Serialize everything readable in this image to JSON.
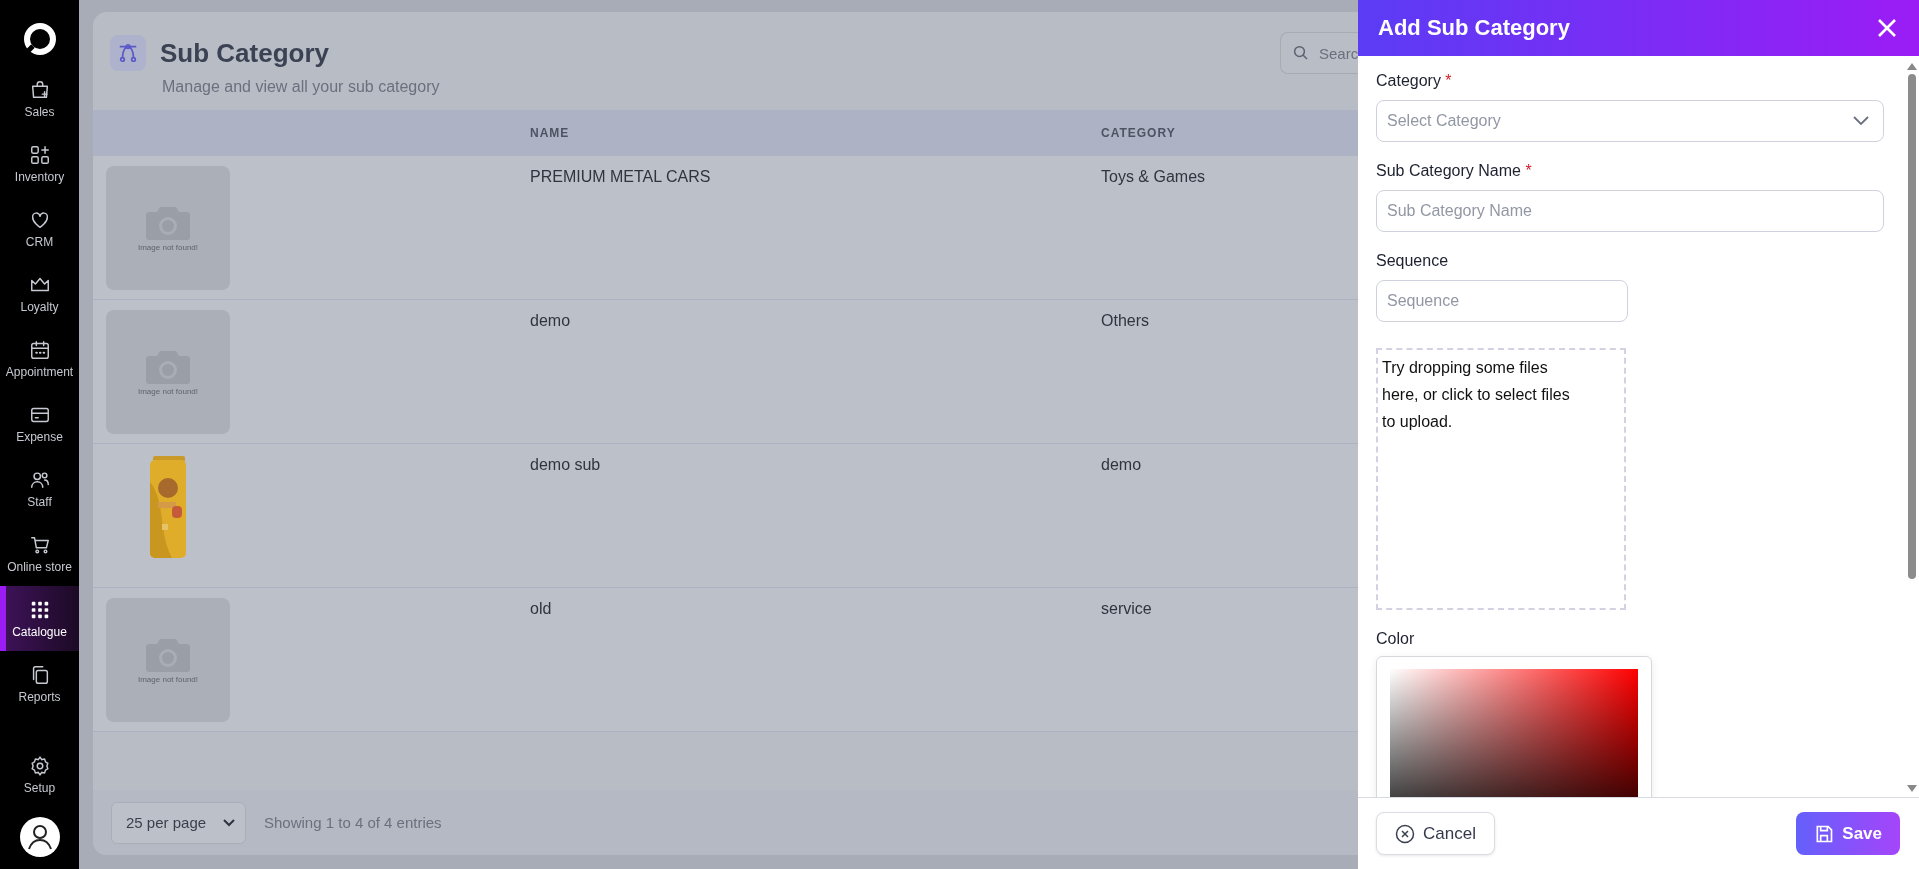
{
  "sidebar": {
    "items": [
      {
        "label": "Sales",
        "selected": false
      },
      {
        "label": "Inventory",
        "selected": false
      },
      {
        "label": "CRM",
        "selected": false
      },
      {
        "label": "Loyalty",
        "selected": false
      },
      {
        "label": "Appointment",
        "selected": false
      },
      {
        "label": "Expense",
        "selected": false
      },
      {
        "label": "Staff",
        "selected": false
      },
      {
        "label": "Online store",
        "selected": false
      },
      {
        "label": "Catalogue",
        "selected": true
      },
      {
        "label": "Reports",
        "selected": false
      }
    ],
    "setup": {
      "label": "Setup"
    }
  },
  "page": {
    "title": "Sub Category",
    "subtitle": "Manage and view all your sub category",
    "search": {
      "placeholder": "Searc"
    }
  },
  "table": {
    "columns": [
      "NAME",
      "CATEGORY"
    ],
    "rows": [
      {
        "image": {
          "kind": "placeholder",
          "text": "Image not found!"
        },
        "name": "PREMIUM METAL CARS",
        "category": "Toys & Games"
      },
      {
        "image": {
          "kind": "placeholder",
          "text": "Image not found!"
        },
        "name": "demo",
        "category": "Others"
      },
      {
        "name": "demo sub",
        "category": "demo"
      },
      {
        "image": {
          "kind": "placeholder",
          "text": "Image not found!"
        },
        "name": "old",
        "category": "service"
      }
    ]
  },
  "pagination": {
    "per_page": "25 per page",
    "summary": "Showing 1 to 4 of 4 entries"
  },
  "drawer": {
    "title": "Add Sub Category",
    "required_mark": "*",
    "fields": [
      {
        "kind": "select",
        "label": "Category",
        "required": true,
        "placeholder": "Select Category"
      },
      {
        "kind": "text",
        "label": "Sub Category Name",
        "required": true,
        "placeholder": "Sub Category Name"
      },
      {
        "kind": "number",
        "label": "Sequence",
        "required": false,
        "placeholder": "Sequence"
      }
    ],
    "dropzone": "Try dropping some files here, or click to select files to upload.",
    "color_label": "Color",
    "buttons": [
      {
        "kind": "cancel",
        "label": "Cancel"
      },
      {
        "kind": "save",
        "label": "Save"
      }
    ]
  }
}
